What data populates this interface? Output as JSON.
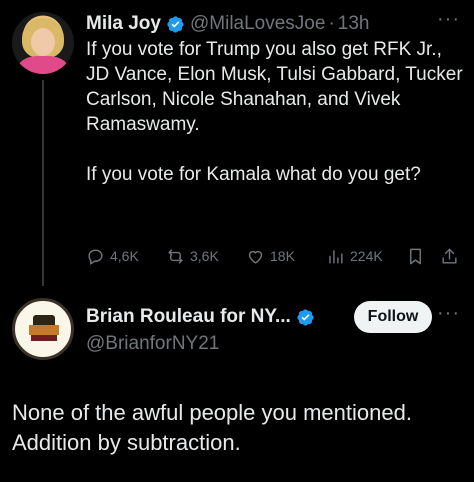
{
  "tweet1": {
    "author_name": "Mila Joy",
    "handle": "@MilaLovesJoe",
    "separator": "·",
    "time": "13h",
    "text_p1": "If you vote for Trump you also get RFK Jr., JD Vance, Elon Musk, Tulsi Gabbard, Tucker Carlson, Nicole Shanahan, and Vivek Ramaswamy.",
    "text_p2": "If you vote for Kamala what do you get?",
    "more": "···",
    "stats": {
      "replies": "4,6K",
      "reposts": "3,6K",
      "likes": "18K",
      "views": "224K"
    }
  },
  "tweet2": {
    "author_name": "Brian Rouleau for NY...",
    "handle": "@BrianforNY21",
    "follow_label": "Follow",
    "more": "···",
    "text": "None of the awful people you mentioned. Addition by subtraction."
  },
  "colors": {
    "background": "#000000",
    "text": "#e7e9ea",
    "secondary": "#71767b",
    "verified": "#1d9bf0"
  },
  "icons": [
    "verified-badge-icon",
    "reply-icon",
    "repost-icon",
    "like-icon",
    "views-icon",
    "bookmark-icon",
    "share-icon",
    "more-icon"
  ]
}
